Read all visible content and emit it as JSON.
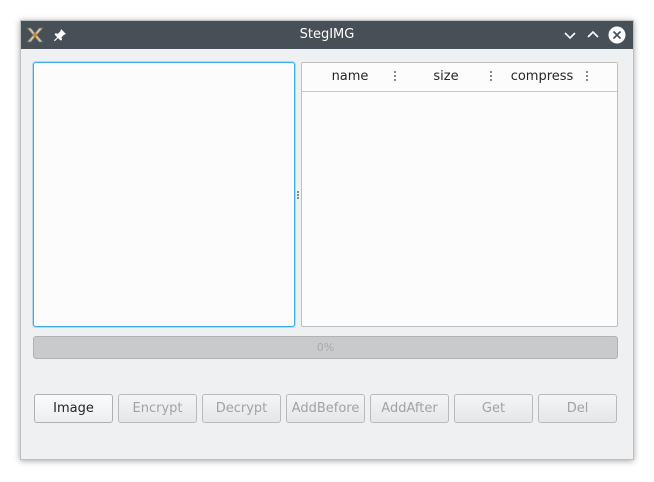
{
  "window": {
    "title": "StegIMG"
  },
  "table": {
    "columns": [
      {
        "label": "name"
      },
      {
        "label": "size"
      },
      {
        "label": "compress"
      }
    ],
    "rows": []
  },
  "progress": {
    "value_percent": 0,
    "text": "0%"
  },
  "buttons": [
    {
      "label": "Image",
      "enabled": true
    },
    {
      "label": "Encrypt",
      "enabled": false
    },
    {
      "label": "Decrypt",
      "enabled": false
    },
    {
      "label": "AddBefore",
      "enabled": false
    },
    {
      "label": "AddAfter",
      "enabled": false
    },
    {
      "label": "Get",
      "enabled": false
    },
    {
      "label": "Del",
      "enabled": false
    }
  ],
  "colors": {
    "titlebar": "#475057",
    "window_bg": "#eff0f1",
    "focus_accent": "#3daee9"
  }
}
